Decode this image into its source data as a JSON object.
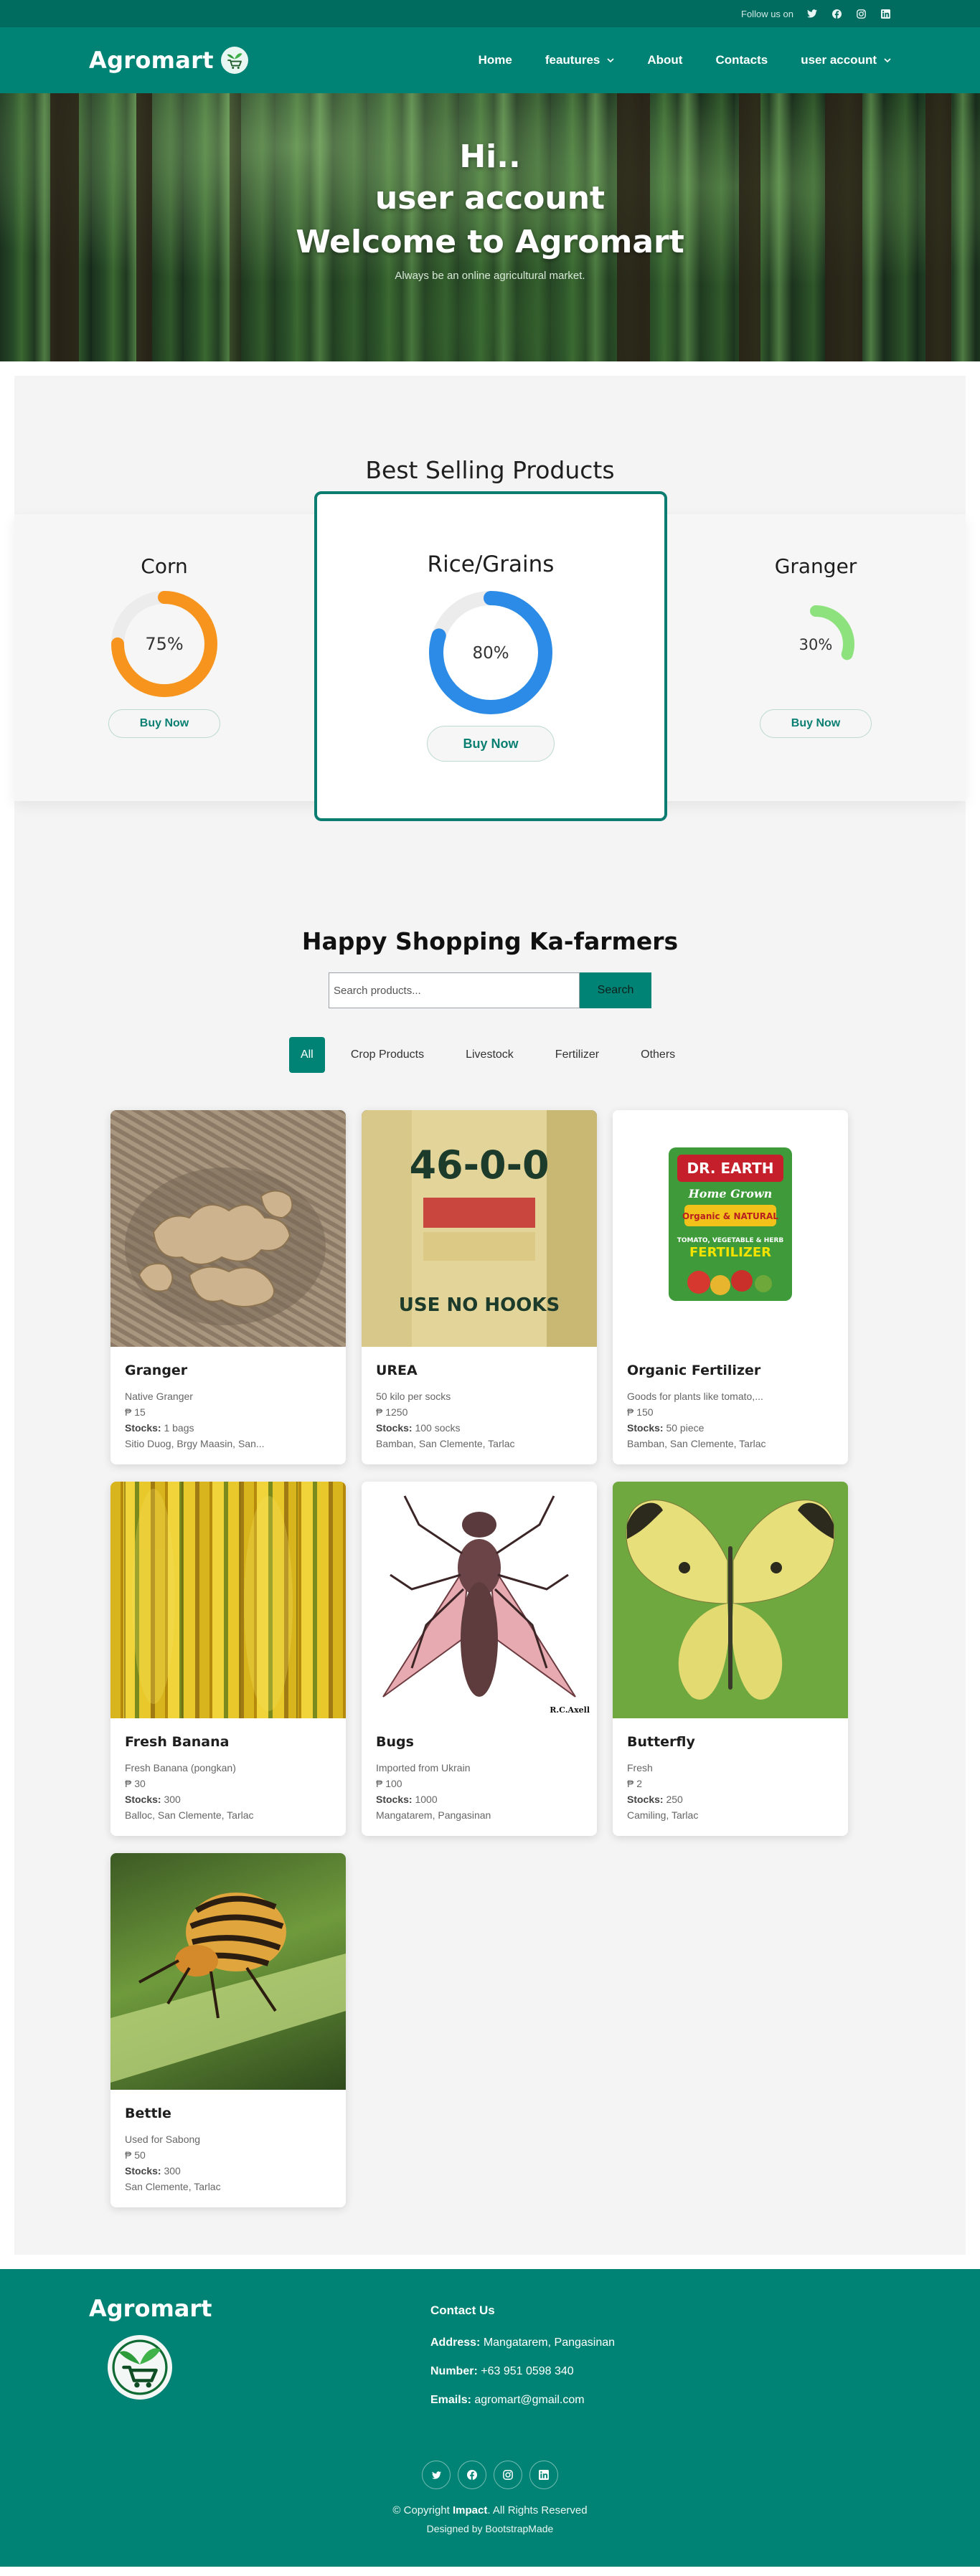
{
  "topbar": {
    "follow_label": "Follow us on",
    "social": [
      "twitter-icon",
      "facebook-icon",
      "instagram-icon",
      "linkedin-icon"
    ]
  },
  "header": {
    "brand": "Agromart",
    "nav": [
      {
        "label": "Home"
      },
      {
        "label": "feautures",
        "dropdown": true
      },
      {
        "label": "About"
      },
      {
        "label": "Contacts"
      },
      {
        "label": "user account",
        "dropdown": true
      }
    ]
  },
  "hero": {
    "line1": "Hi..",
    "line2": "user account",
    "line3": "Welcome to Agromart",
    "subtitle": "Always be an online agricultural market."
  },
  "best_selling": {
    "title": "Best Selling Products",
    "products": [
      {
        "name": "Corn",
        "percent": 75,
        "percent_label": "75%",
        "color": "#f7941d",
        "button": "Buy Now"
      },
      {
        "name": "Rice/Grains",
        "percent": 80,
        "percent_label": "80%",
        "color": "#2b8be6",
        "button": "Buy Now"
      },
      {
        "name": "Granger",
        "percent": 30,
        "percent_label": "30%",
        "color": "#8ee27e",
        "button": "Buy Now"
      }
    ]
  },
  "shop": {
    "title": "Happy Shopping Ka-farmers",
    "search_placeholder": "Search products...",
    "search_button": "Search",
    "filters": [
      "All",
      "Crop Products",
      "Livestock",
      "Fertilizer",
      "Others"
    ],
    "active_filter": "All",
    "stocks_label": "Stocks:",
    "products": [
      {
        "name": "Granger",
        "desc": "Native Granger",
        "price": "₱ 15",
        "stocks": "1 bags",
        "location": "Sitio Duog, Brgy Maasin, San..."
      },
      {
        "name": "UREA",
        "desc": "50 kilo per socks",
        "price": "₱ 1250",
        "stocks": "100 socks",
        "location": "Bamban, San Clemente, Tarlac"
      },
      {
        "name": "Organic Fertilizer",
        "desc": "Goods for plants like tomato,...",
        "price": "₱ 150",
        "stocks": "50 piece",
        "location": "Bamban, San Clemente, Tarlac"
      },
      {
        "name": "Fresh Banana",
        "desc": "Fresh Banana (pongkan)",
        "price": "₱ 30",
        "stocks": "300",
        "location": "Balloc, San Clemente, Tarlac"
      },
      {
        "name": "Bugs",
        "desc": "Imported from Ukrain",
        "price": "₱ 100",
        "stocks": "1000",
        "location": "Mangatarem, Pangasinan"
      },
      {
        "name": "Butterfly",
        "desc": "Fresh",
        "price": "₱ 2",
        "stocks": "250",
        "location": "Camiling, Tarlac"
      },
      {
        "name": "Bettle",
        "desc": "Used for Sabong",
        "price": "₱ 50",
        "stocks": "300",
        "location": "San Clemente, Tarlac"
      }
    ],
    "image_texts": {
      "urea_bag": "46-0-0",
      "urea_bag_bottom": "USE NO HOOKS",
      "fert_brand": "DR. EARTH",
      "fert_line1": "Home Grown",
      "fert_line2": "Organic & NATURAL",
      "fert_line3": "TOMATO, VEGETABLE & HERB",
      "fert_line4": "FERTILIZER",
      "bug_credit": "R.C.Axell"
    }
  },
  "footer": {
    "brand": "Agromart",
    "contact_title": "Contact Us",
    "address_label": "Address:",
    "address": "Mangatarem, Pangasinan",
    "number_label": "Number:",
    "number": "+63 951 0598 340",
    "email_label": "Emails:",
    "email": "agromart@gmail.com",
    "social": [
      "twitter-icon",
      "facebook-icon",
      "instagram-icon",
      "linkedin-icon"
    ],
    "copyright_prefix": "© Copyright",
    "copyright_brand": "Impact",
    "copyright_suffix": ". All Rights Reserved",
    "credit": "Designed by BootstrapMade"
  }
}
